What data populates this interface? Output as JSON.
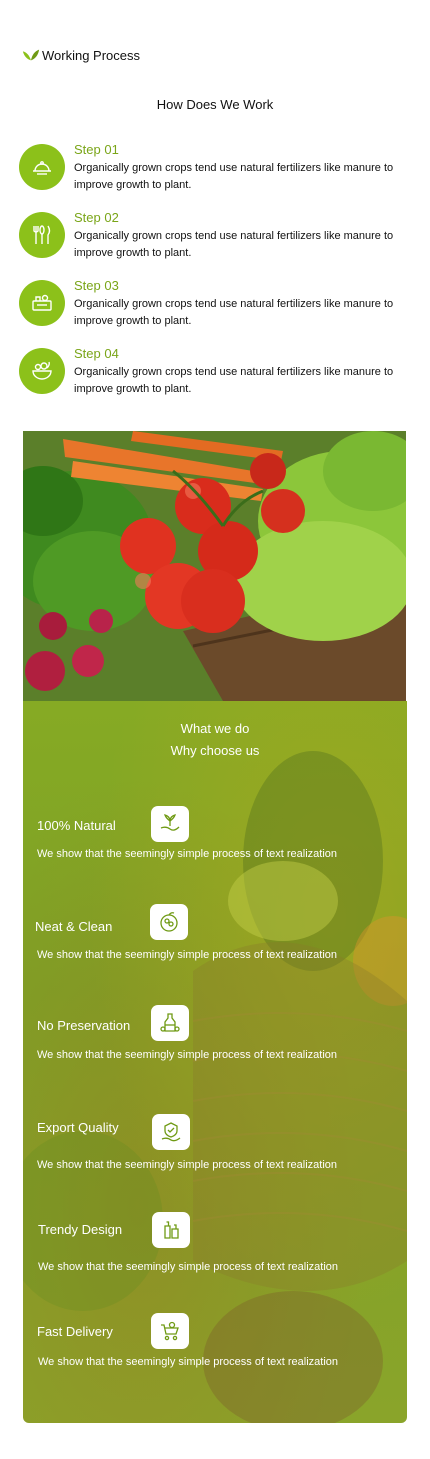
{
  "header": {
    "title": "Working Process",
    "icon": "leaf-icon"
  },
  "subtitle": "How Does We Work",
  "accent": "#8cc11a",
  "steps": [
    {
      "label": "Step 01",
      "icon": "serving-dish-icon",
      "desc": "Organically grown crops tend use natural fertilizers like manure to improve growth to plant."
    },
    {
      "label": "Step 02",
      "icon": "cutlery-icon",
      "desc": "Organically grown crops tend use natural fertilizers like manure to improve growth to plant."
    },
    {
      "label": "Step 03",
      "icon": "groceries-icon",
      "desc": "Organically grown crops tend use natural fertilizers like manure to improve growth to plant."
    },
    {
      "label": "Step 04",
      "icon": "salad-bowl-icon",
      "desc": "Organically grown crops tend use natural fertilizers like manure to improve growth to plant."
    }
  ],
  "panel": {
    "title1": "What we do",
    "title2": "Why choose us",
    "features": [
      {
        "name": "100% Natural",
        "icon": "plant-hand-icon",
        "desc": "We show that the seemingly simple process of text realization"
      },
      {
        "name": "Neat & Clean",
        "icon": "fruit-basket-icon",
        "desc": "We show that the seemingly simple process of text realization"
      },
      {
        "name": "No Preservation",
        "icon": "oil-bottle-icon",
        "desc": "We show that the seemingly simple process of text realization"
      },
      {
        "name": "Export  Quality",
        "icon": "quality-badge-icon",
        "desc": "We show that the seemingly simple process of text realization"
      },
      {
        "name": "Trendy Design",
        "icon": "bottles-icon",
        "desc": "We show that the seemingly simple process of text realization"
      },
      {
        "name": "Fast Delivery",
        "icon": "delivery-cart-icon",
        "desc": "We show that the seemingly simple process of text realization"
      }
    ]
  }
}
